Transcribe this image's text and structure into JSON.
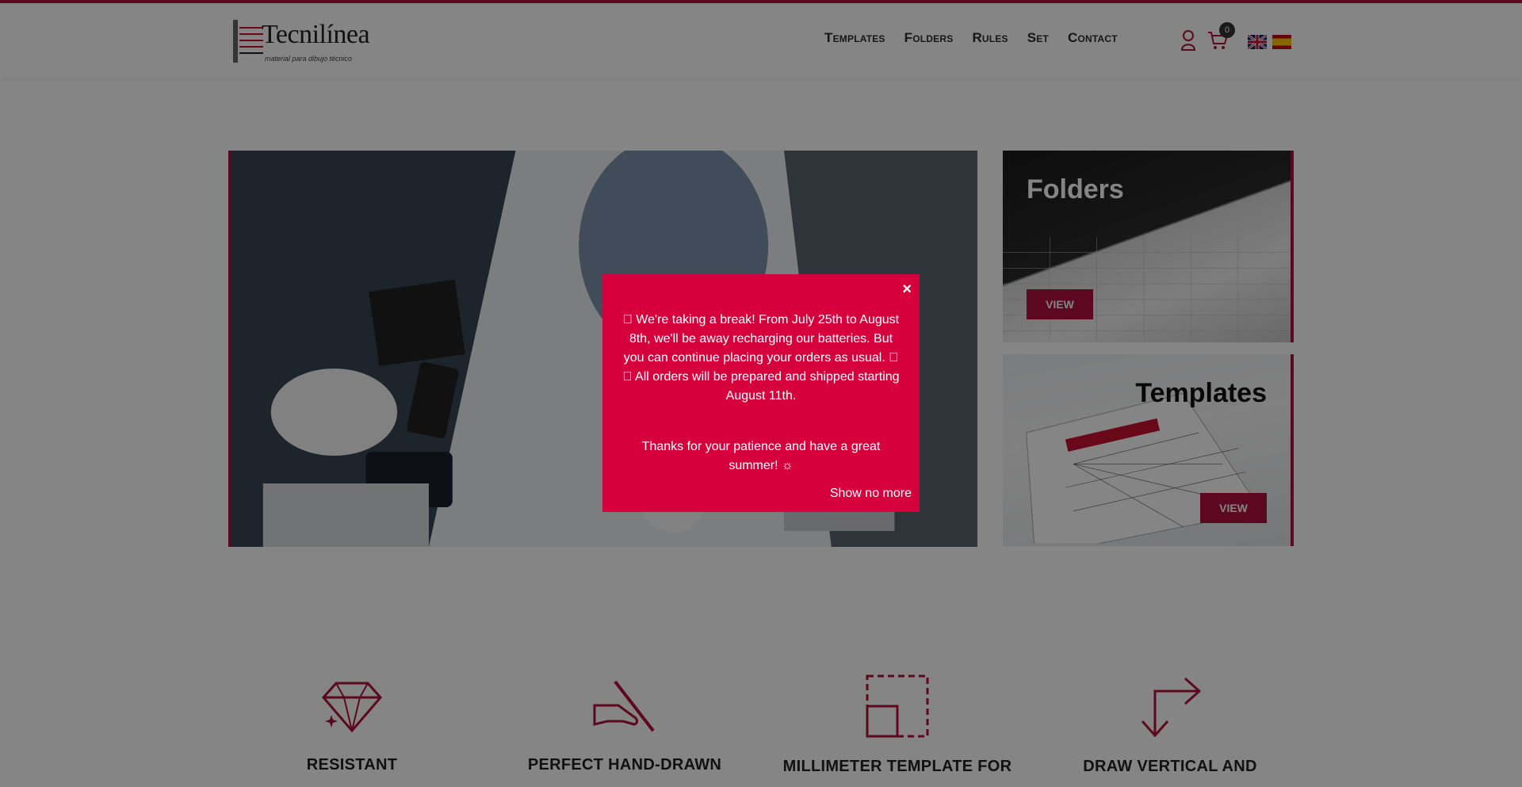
{
  "header": {
    "logo_word": "Tecnilínea",
    "logo_tagline": "material para dibujo técnico",
    "nav": [
      "Templates",
      "Folders",
      "Rules",
      "Set",
      "Contact"
    ],
    "cart_count": "0",
    "languages": [
      "en-flag-icon",
      "es-flag-icon"
    ]
  },
  "cards": {
    "folders": {
      "title": "Folders",
      "button": "VIEW"
    },
    "templates": {
      "title": "Templates",
      "button": "VIEW"
    }
  },
  "features": [
    {
      "title": "RESISTANT",
      "icon": "diamond-icon"
    },
    {
      "title": "PERFECT HAND-DRAWN",
      "icon": "hand-pen-icon"
    },
    {
      "title": "MILLIMETER TEMPLATE FOR",
      "icon": "dashed-square-icon"
    },
    {
      "title": "DRAW VERTICAL AND",
      "icon": "corner-arrows-icon"
    }
  ],
  "modal": {
    "close": "×",
    "message": "\u0000 We're taking a break! From July 25th to August 8th, we'll be away recharging our batteries. But you can continue placing your orders as usual. \u0000 \u0000 All orders will be prepared and shipped starting August 11th.",
    "thanks": "Thanks for your patience and have a great summer! ☼",
    "dismiss": "Show no more"
  },
  "colors": {
    "accent": "#b0103f",
    "modal_bg": "#d6003d",
    "overlay": "rgba(0,0,0,0.48)"
  }
}
